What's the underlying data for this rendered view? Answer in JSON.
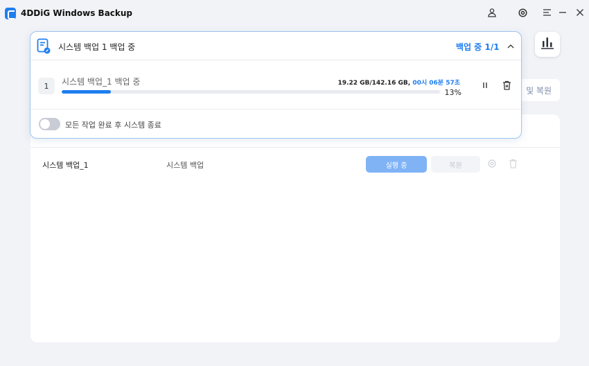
{
  "app": {
    "title": "4DDiG Windows Backup"
  },
  "icons": {
    "logo": "app-logo-icon",
    "account": "user-icon",
    "settings": "gear-icon",
    "menu": "menu-icon",
    "minimize": "minimize-icon",
    "close": "close-icon",
    "stats": "bar-chart-icon",
    "pause": "pause-icon",
    "delete": "trash-icon"
  },
  "colors": {
    "accent": "#1f7ef0",
    "run_button": "#7fb3f6",
    "popup_border": "#9ec4ef"
  },
  "side": {
    "restore_tab_label": "및 복원"
  },
  "popup": {
    "title": "시스템 백업 1 백업 중",
    "status": "백업 중 1/1",
    "task": {
      "number": "1",
      "name": "시스템 백업_1 백업 중",
      "size": "19.22 GB/142.16 GB",
      "separator": ",",
      "time_remaining": "00시 06분 57초",
      "progress_percent": 13,
      "progress_label": "13%"
    },
    "shutdown_toggle": {
      "label": "모든 작업 완료 후 시스템 종료",
      "on": false
    }
  },
  "backups": [
    {
      "name": "시스템 백업_1",
      "type": "시스템 백업",
      "run_label": "실행 중",
      "restore_label": "복원"
    }
  ]
}
